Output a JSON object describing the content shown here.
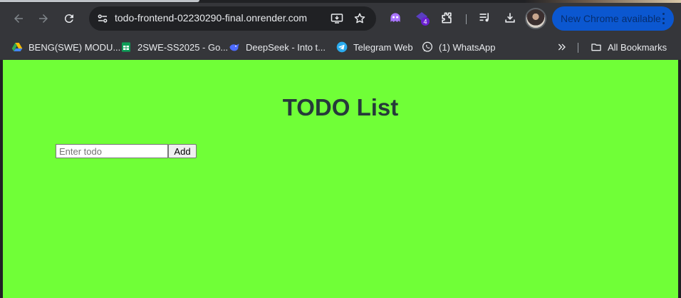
{
  "browser": {
    "url": "todo-frontend-02230290-final.onrender.com",
    "update_label": "New Chrome available",
    "extension_badge": "4",
    "colors": {
      "frame": "#35363a",
      "omnibox": "#202124",
      "update_pill": "#0b57d0"
    }
  },
  "bookmarks": {
    "items": [
      {
        "label": "BENG(SWE) MODU...",
        "icon": "google-drive-icon"
      },
      {
        "label": "2SWE-SS2025 - Go...",
        "icon": "google-sheets-icon"
      },
      {
        "label": "DeepSeek - Into t...",
        "icon": "deepseek-icon"
      },
      {
        "label": "Telegram Web",
        "icon": "telegram-icon"
      },
      {
        "label": "(1) WhatsApp",
        "icon": "whatsapp-icon"
      }
    ],
    "all_label": "All Bookmarks"
  },
  "page": {
    "title": "TODO List",
    "input_placeholder": "Enter todo",
    "input_value": "",
    "add_label": "Add",
    "colors": {
      "background": "#70ff37",
      "title": "#263a3a"
    }
  }
}
